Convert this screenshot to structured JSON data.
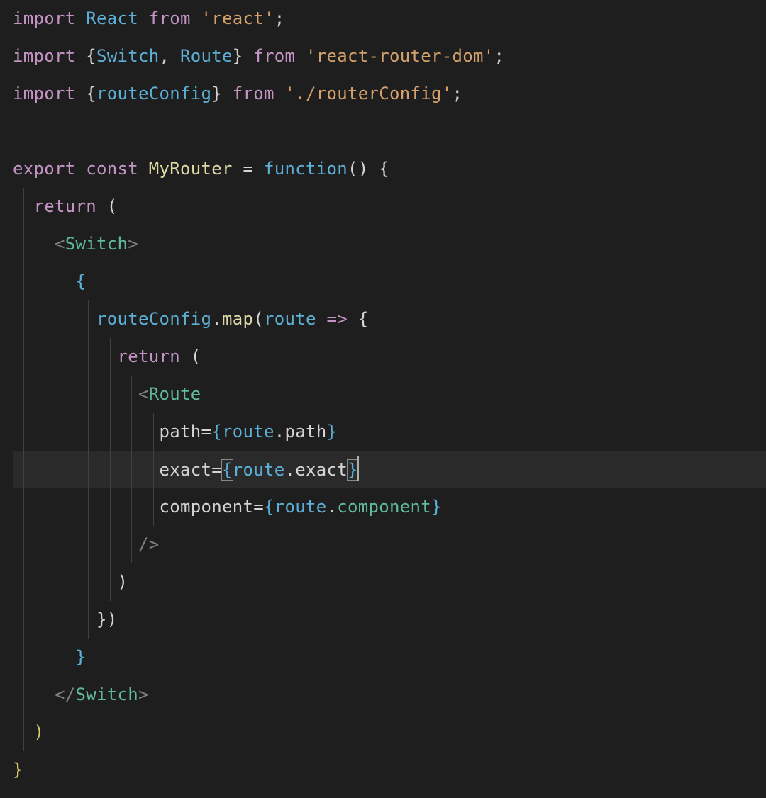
{
  "code": {
    "l1": {
      "kw_import": "import",
      "React": "React",
      "kw_from": "from",
      "str_react": "'react'",
      "semi": ";"
    },
    "l2": {
      "kw_import": "import",
      "lbrace": "{",
      "Switch": "Switch",
      "comma": ",",
      "Route": "Route",
      "rbrace": "}",
      "kw_from": "from",
      "str_rrd": "'react-router-dom'",
      "semi": ";"
    },
    "l3": {
      "kw_import": "import",
      "lbrace": "{",
      "routeConfig": "routeConfig",
      "rbrace": "}",
      "kw_from": "from",
      "str_rc": "'./routerConfig'",
      "semi": ";"
    },
    "l5": {
      "kw_export": "export",
      "kw_const": "const",
      "MyRouter": "MyRouter",
      "eq": "=",
      "kw_function": "function",
      "paren": "()",
      "lbrace": "{"
    },
    "l6": {
      "kw_return": "return",
      "paren": "("
    },
    "l7": {
      "lt": "<",
      "Switch": "Switch",
      "gt": ">"
    },
    "l8": {
      "lbrace": "{"
    },
    "l9": {
      "routeConfig": "routeConfig",
      "dot": ".",
      "map": "map",
      "lparen": "(",
      "route": "route",
      "arrow": "=>",
      "lbrace": "{"
    },
    "l10": {
      "kw_return": "return",
      "lparen": "("
    },
    "l11": {
      "lt": "<",
      "Route": "Route"
    },
    "l12": {
      "path": "path",
      "eq": "=",
      "lbrace": "{",
      "route": "route",
      "dot": ".",
      "prop": "path",
      "rbrace": "}"
    },
    "l13": {
      "exact": "exact",
      "eq": "=",
      "lbrace": "{",
      "route": "route",
      "dot": ".",
      "prop": "exact",
      "rbrace": "}"
    },
    "l14": {
      "component": "component",
      "eq": "=",
      "lbrace": "{",
      "route": "route",
      "dot": ".",
      "prop": "component",
      "rbrace": "}"
    },
    "l15": {
      "close": "/>"
    },
    "l16": {
      "rparen": ")"
    },
    "l17": {
      "rbrace": "}",
      "rparen": ")"
    },
    "l18": {
      "rbrace": "}"
    },
    "l19": {
      "lt": "</",
      "Switch": "Switch",
      "gt": ">"
    },
    "l20": {
      "rparen": ")"
    },
    "l21": {
      "rbrace": "}"
    }
  }
}
